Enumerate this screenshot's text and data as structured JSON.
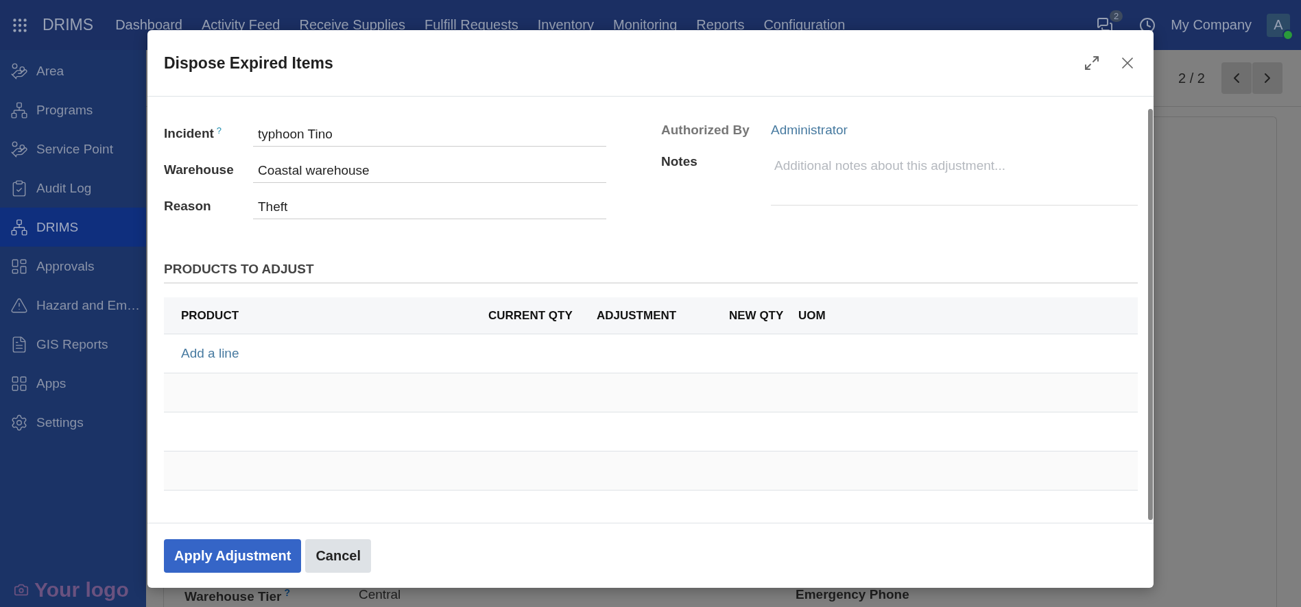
{
  "topbar": {
    "app_name": "DRIMS",
    "menu": [
      "Dashboard",
      "Activity Feed",
      "Receive Supplies",
      "Fulfill Requests",
      "Inventory",
      "Monitoring",
      "Reports",
      "Configuration"
    ],
    "message_count": "2",
    "company": "My Company",
    "avatar": "A"
  },
  "sidebar": {
    "items": [
      {
        "label": "Area",
        "selected": false
      },
      {
        "label": "Programs",
        "selected": false
      },
      {
        "label": "Service Point",
        "selected": false
      },
      {
        "label": "Audit Log",
        "selected": false
      },
      {
        "label": "DRIMS",
        "selected": true
      },
      {
        "label": "Approvals",
        "selected": false
      },
      {
        "label": "Hazard and Em…",
        "selected": false
      },
      {
        "label": "GIS Reports",
        "selected": false
      },
      {
        "label": "Apps",
        "selected": false
      },
      {
        "label": "Settings",
        "selected": false
      }
    ],
    "logo": "Your logo"
  },
  "control_panel": {
    "pager": "2 / 2"
  },
  "background_form": {
    "fields": [
      {
        "label": "Warehouse Tier",
        "help": "?",
        "value": "Central"
      },
      {
        "label": "Emergency Phone"
      }
    ]
  },
  "dialog": {
    "title": "Dispose Expired Items",
    "fields": [
      {
        "label": "Incident",
        "help": "?",
        "value": "typhoon Tino"
      },
      {
        "label": "Warehouse",
        "value": "Coastal warehouse"
      },
      {
        "label": "Reason",
        "value": "Theft"
      }
    ],
    "right_fields": [
      {
        "kind": "link",
        "label": "Authorized By",
        "value": "Administrator"
      },
      {
        "kind": "textarea",
        "label": "Notes",
        "placeholder": "Additional notes about this adjustment..."
      }
    ],
    "section_title": "PRODUCTS TO ADJUST",
    "table": {
      "columns": [
        "PRODUCT",
        "CURRENT QTY",
        "ADJUSTMENT",
        "NEW QTY",
        "UOM"
      ],
      "add_line": "Add a line"
    },
    "buttons": [
      {
        "kind": "primary",
        "label": "Apply Adjustment"
      },
      {
        "kind": "secondary",
        "label": "Cancel"
      }
    ]
  }
}
